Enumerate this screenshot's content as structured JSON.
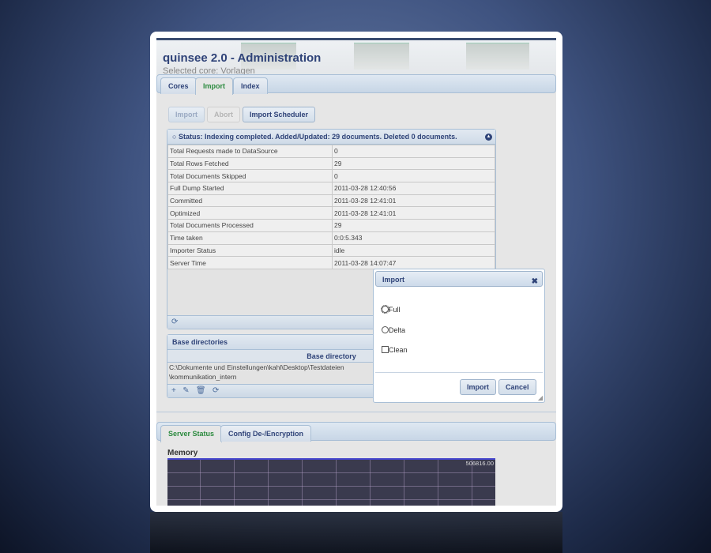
{
  "app": {
    "title": "quinsee 2.0 - Administration",
    "selected_core": "Selected core: Vorlagen"
  },
  "tabs": [
    {
      "label": "Cores"
    },
    {
      "label": "Import"
    },
    {
      "label": "Index"
    }
  ],
  "toolbar": {
    "import": "Import",
    "abort": "Abort",
    "scheduler": "Import Scheduler"
  },
  "status": {
    "title": "Status: Indexing completed. Added/Updated: 29 documents. Deleted 0 documents.",
    "rows": [
      {
        "label": "Total Requests made to DataSource",
        "value": "0"
      },
      {
        "label": "Total Rows Fetched",
        "value": "29"
      },
      {
        "label": "Total Documents Skipped",
        "value": "0"
      },
      {
        "label": "Full Dump Started",
        "value": "2011-03-28 12:40:56"
      },
      {
        "label": "Committed",
        "value": "2011-03-28 12:41:01"
      },
      {
        "label": "Optimized",
        "value": "2011-03-28 12:41:01"
      },
      {
        "label": "Total Documents Processed",
        "value": "29"
      },
      {
        "label": "Time taken",
        "value": "0:0:5.343"
      },
      {
        "label": "Importer Status",
        "value": "idle"
      },
      {
        "label": "Server Time",
        "value": "2011-03-28 14:07:47"
      }
    ]
  },
  "base_dirs": {
    "title": "Base directories",
    "column": "Base directory",
    "row_line1": "C:\\Dokumente und Einstellungen\\kahl\\Desktop\\Testdateien",
    "row_line2": "\\kommunikation_intern"
  },
  "dialog": {
    "title": "Import",
    "options": [
      {
        "label": "Full"
      },
      {
        "label": "Delta"
      },
      {
        "label": "Clean"
      }
    ],
    "ok": "Import",
    "cancel": "Cancel"
  },
  "bottom_tabs": [
    {
      "label": "Server Status"
    },
    {
      "label": "Config De-/Encryption"
    }
  ],
  "memory": {
    "title": "Memory",
    "max_label": "506816.00"
  }
}
